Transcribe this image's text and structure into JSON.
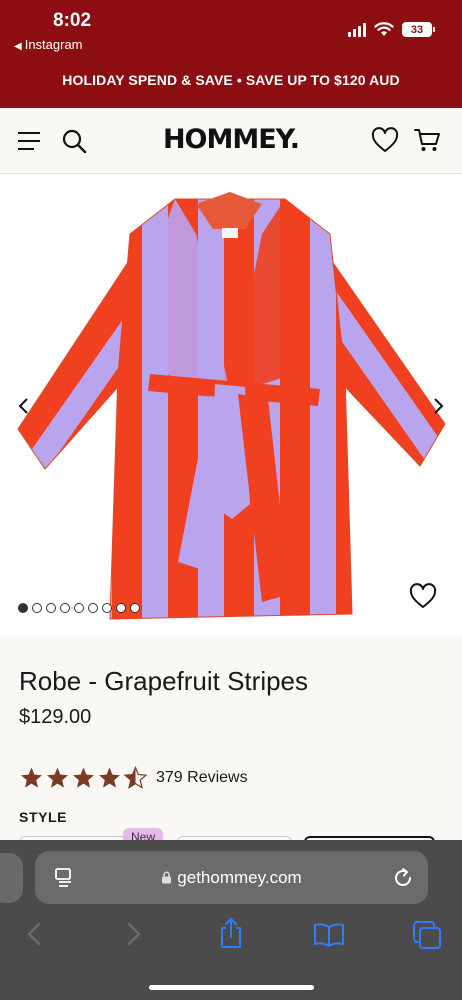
{
  "status_bar": {
    "time": "8:02",
    "back_label": "Instagram",
    "battery": "33"
  },
  "promo_banner": {
    "text": "HOLIDAY SPEND & SAVE • SAVE UP TO $120 AUD"
  },
  "header": {
    "logo": "HOMMEY.",
    "icons": [
      "menu-icon",
      "search-icon",
      "heart-icon",
      "cart-icon"
    ]
  },
  "gallery": {
    "image_count": 9,
    "active_index": 0,
    "image_description": "striped robe",
    "colors": {
      "stripe_red": "#f0401f",
      "stripe_lilac": "#b9a4ee"
    }
  },
  "product": {
    "title": "Robe - Grapefruit Stripes",
    "price": "$129.00",
    "rating": 4.5,
    "rating_max": 5,
    "reviews": "379 Reviews",
    "style_label": "STYLE",
    "style_badge": "New",
    "star_color": "#7a3a24"
  },
  "safari": {
    "url": "gethommey.com",
    "icons": [
      "reader-icon",
      "lock-icon",
      "reload-icon",
      "back-icon",
      "forward-icon",
      "share-icon",
      "bookmarks-icon",
      "tabs-icon"
    ]
  },
  "colors": {
    "brand_red": "#8c0e12",
    "background": "#faf8f4",
    "safari_bar": "#4b4b4b",
    "accent_blue": "#2f7cf6"
  }
}
